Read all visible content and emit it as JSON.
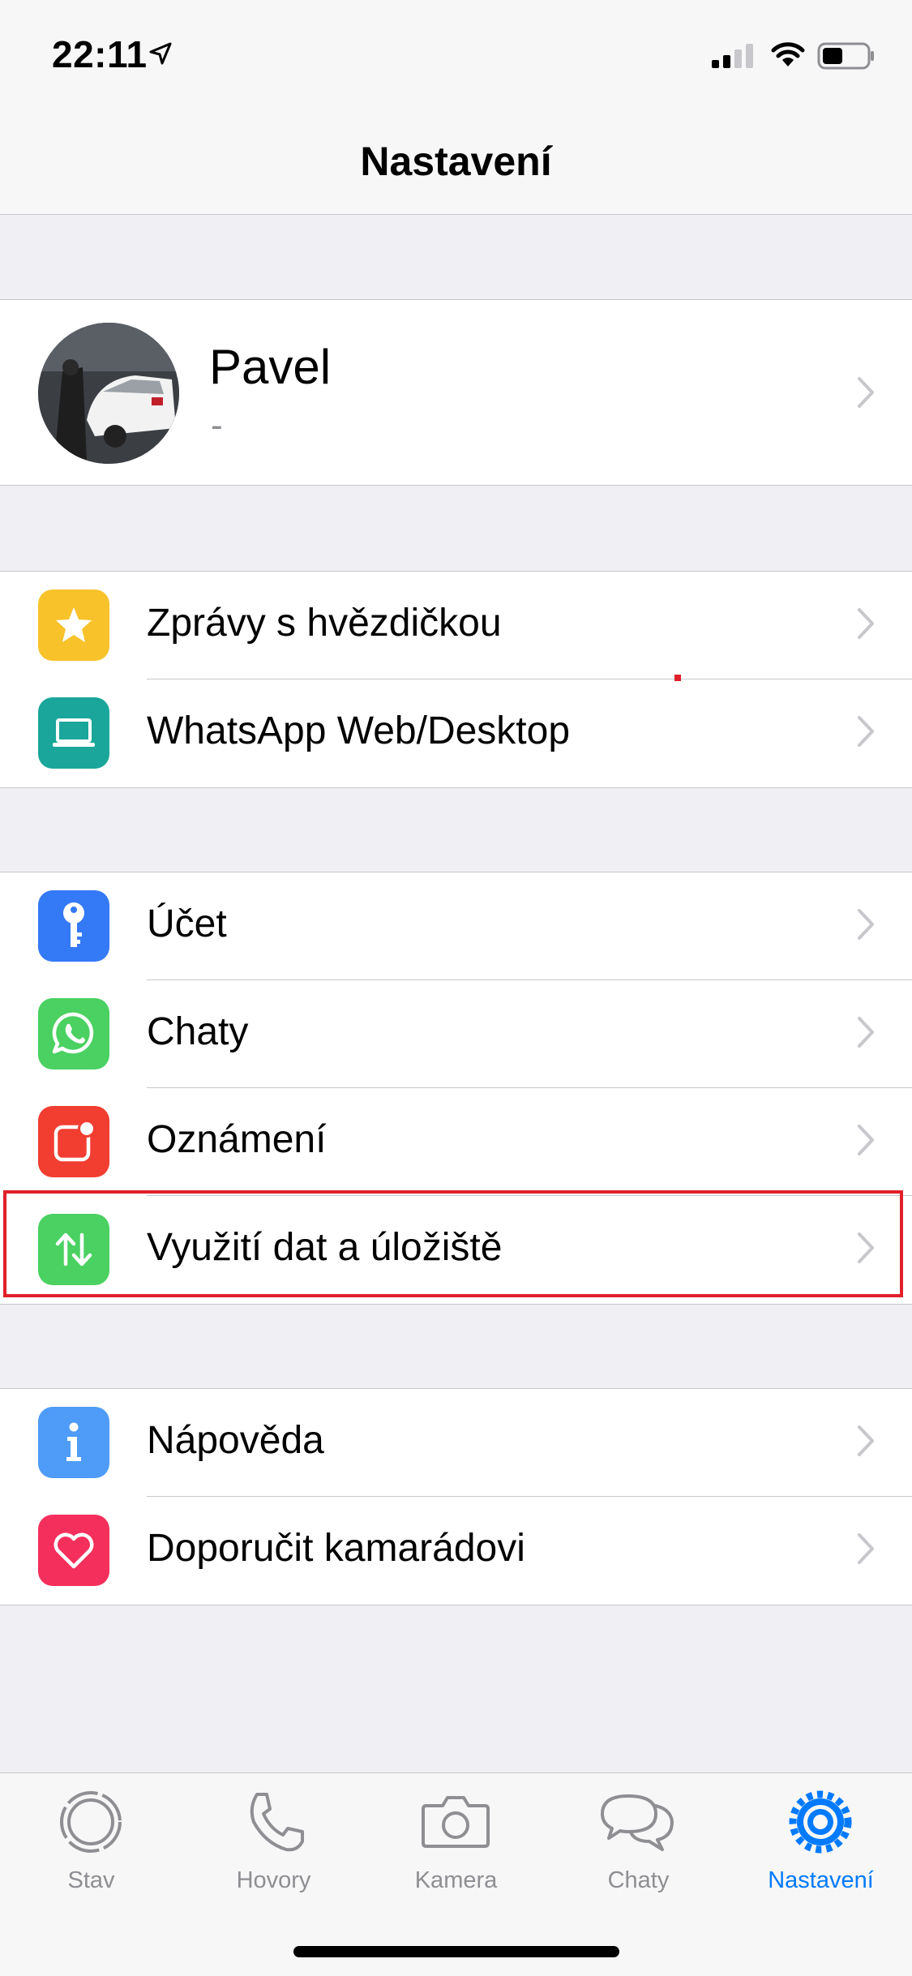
{
  "status_bar": {
    "time": "22:11"
  },
  "nav": {
    "title": "Nastavení"
  },
  "profile": {
    "name": "Pavel",
    "status": "-"
  },
  "groups": [
    {
      "items": [
        {
          "label": "Zprávy s hvězdičkou",
          "icon": "star-icon",
          "color": "#f8c22b"
        },
        {
          "label": "WhatsApp Web/Desktop",
          "icon": "laptop-icon",
          "color": "#1aa69a"
        }
      ]
    },
    {
      "items": [
        {
          "label": "Účet",
          "icon": "key-icon",
          "color": "#3479f6"
        },
        {
          "label": "Chaty",
          "icon": "whatsapp-icon",
          "color": "#4ad161"
        },
        {
          "label": "Oznámení",
          "icon": "notification-icon",
          "color": "#f23d31"
        },
        {
          "label": "Využití dat a úložiště",
          "icon": "data-arrows-icon",
          "color": "#4ad161"
        }
      ]
    },
    {
      "items": [
        {
          "label": "Nápověda",
          "icon": "info-icon",
          "color": "#4e9cf7"
        },
        {
          "label": "Doporučit kamarádovi",
          "icon": "heart-icon",
          "color": "#f52f5c"
        }
      ]
    }
  ],
  "tabs": [
    {
      "label": "Stav",
      "icon": "status-icon",
      "active": false
    },
    {
      "label": "Hovory",
      "icon": "phone-icon",
      "active": false
    },
    {
      "label": "Kamera",
      "icon": "camera-icon",
      "active": false
    },
    {
      "label": "Chaty",
      "icon": "chats-icon",
      "active": false
    },
    {
      "label": "Nastavení",
      "icon": "settings-gear-icon",
      "active": true
    }
  ],
  "colors": {
    "accent": "#007aff",
    "highlight": "#e0202a"
  }
}
